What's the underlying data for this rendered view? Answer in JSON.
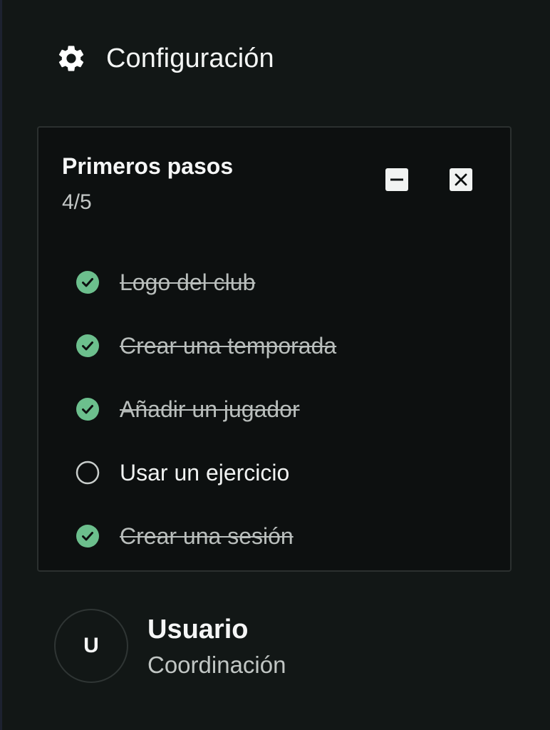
{
  "settings": {
    "label": "Configuración",
    "icon": "gear-icon"
  },
  "onboarding": {
    "title": "Primeros pasos",
    "progress": "4/5",
    "minimize_icon": "minimize-icon",
    "close_icon": "close-icon",
    "tasks": [
      {
        "label": "Logo del club",
        "done": true
      },
      {
        "label": "Crear una temporada",
        "done": true
      },
      {
        "label": "Añadir un jugador",
        "done": true
      },
      {
        "label": "Usar un ejercicio",
        "done": false
      },
      {
        "label": "Crear una sesión",
        "done": true
      }
    ]
  },
  "user": {
    "initial": "U",
    "name": "Usuario",
    "role": "Coordinación"
  },
  "colors": {
    "background": "#121716",
    "card_background": "#0d1010",
    "accent_check": "#6cbf8d",
    "text_primary": "#f1f3f2",
    "text_muted": "#b9bebc"
  }
}
